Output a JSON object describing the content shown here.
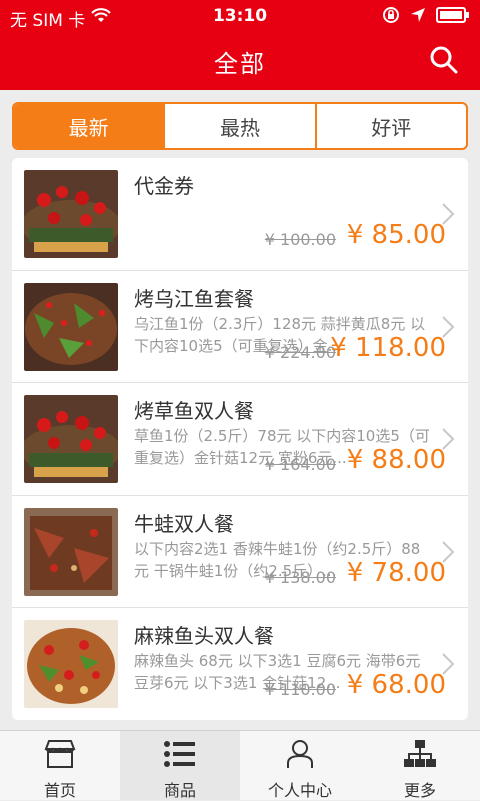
{
  "status_bar": {
    "carrier": "无 SIM 卡",
    "time": "13:10"
  },
  "header": {
    "title": "全部",
    "search_icon": "search-icon"
  },
  "segments": [
    {
      "label": "最新",
      "active": true
    },
    {
      "label": "最热",
      "active": false
    },
    {
      "label": "好评",
      "active": false
    }
  ],
  "items": [
    {
      "title": "代金券",
      "desc": "",
      "old_price": "¥ 100.00",
      "new_price": "¥  85.00"
    },
    {
      "title": "烤乌江鱼套餐",
      "desc": "乌江鱼1份（2.3斤）128元 蒜拌黄瓜8元 以下内容10选5（可重复选）金...",
      "old_price": "¥ 224.00",
      "new_price": "¥  118.00"
    },
    {
      "title": "烤草鱼双人餐",
      "desc": "草鱼1份（2.5斤）78元 以下内容10选5（可重复选）金针菇12元 宽粉6元...",
      "old_price": "¥ 164.00",
      "new_price": "¥  88.00"
    },
    {
      "title": "牛蛙双人餐",
      "desc": "以下内容2选1 香辣牛蛙1份（约2.5斤）88元 干锅牛蛙1份（约2.5斤）...",
      "old_price": "¥ 138.00",
      "new_price": "¥  78.00"
    },
    {
      "title": "麻辣鱼头双人餐",
      "desc": "麻辣鱼头 68元 以下3选1 豆腐6元 海带6元 豆芽6元 以下3选1 金针菇12...",
      "old_price": "¥ 110.00",
      "new_price": "¥  68.00"
    }
  ],
  "tabbar": [
    {
      "label": "首页",
      "icon": "store-icon",
      "active": false
    },
    {
      "label": "商品",
      "icon": "list-icon",
      "active": true
    },
    {
      "label": "个人中心",
      "icon": "user-icon",
      "active": false
    },
    {
      "label": "更多",
      "icon": "sitemap-icon",
      "active": false
    }
  ],
  "colors": {
    "brand_red": "#e60012",
    "accent_orange": "#f57d17"
  }
}
